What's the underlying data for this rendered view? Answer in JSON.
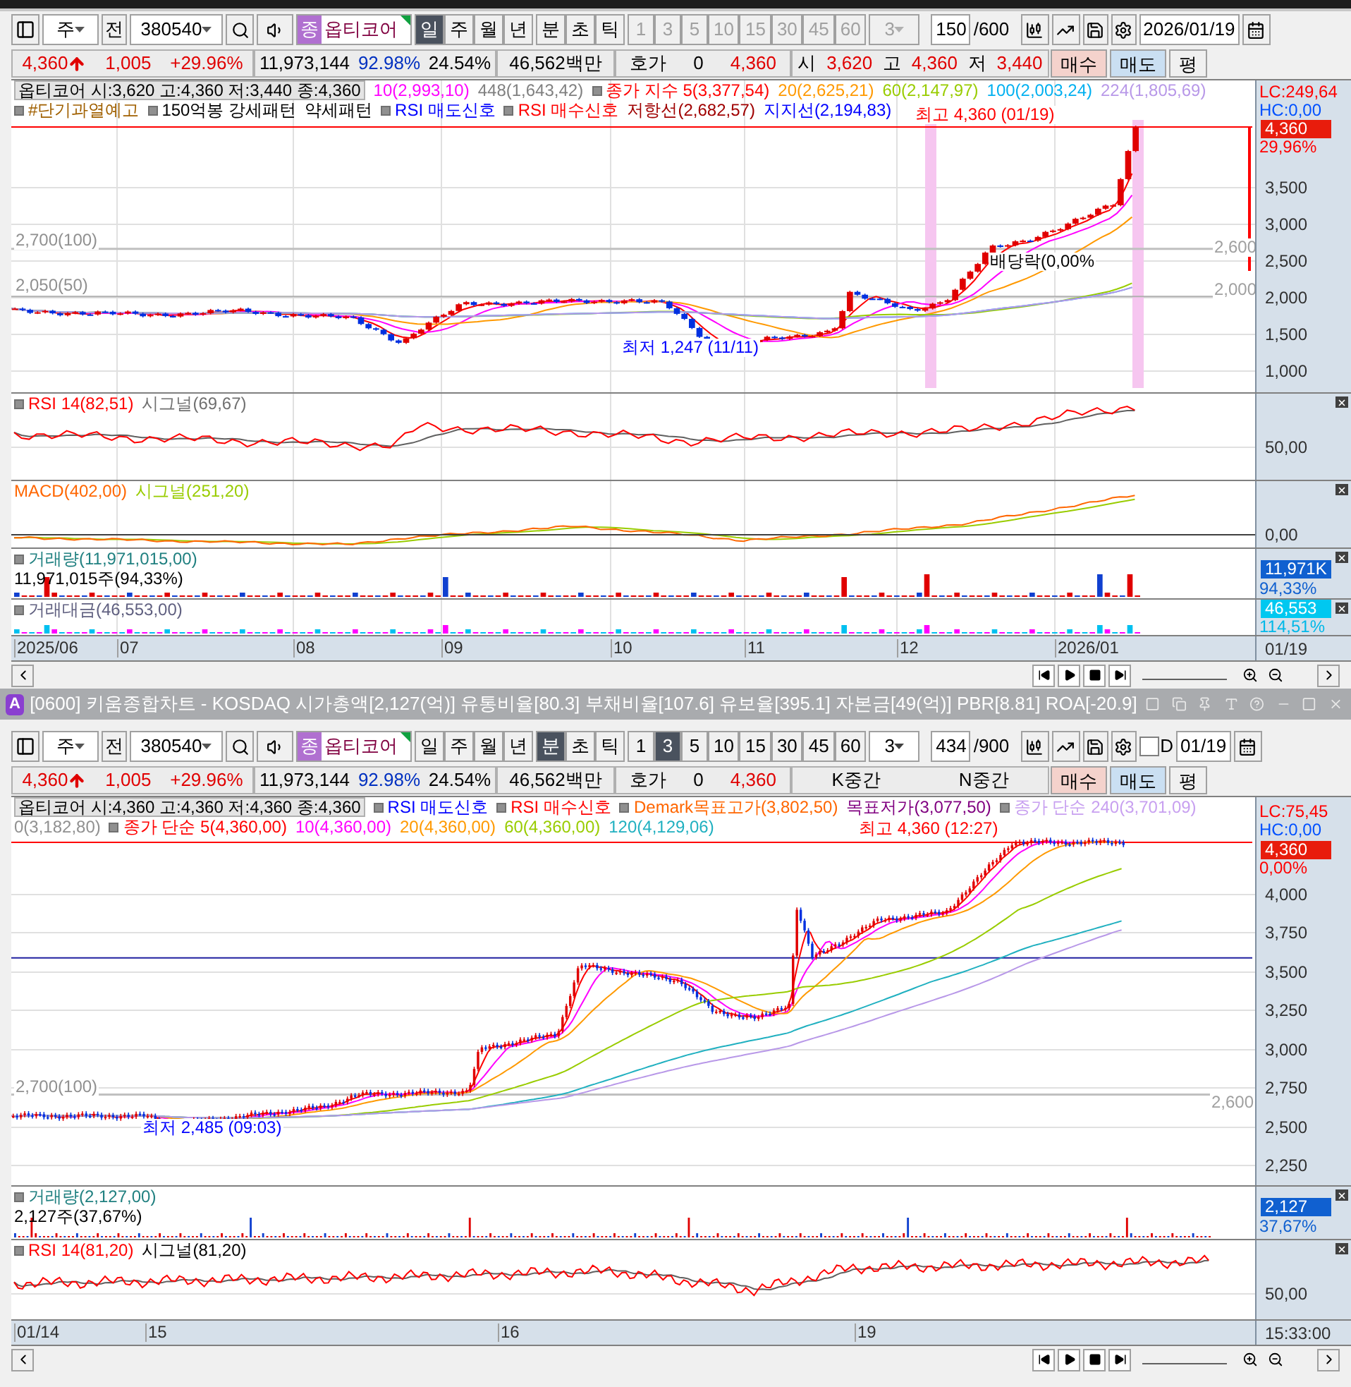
{
  "windows": [
    {
      "toolbar": {
        "market": "주",
        "prev": "전",
        "code": "380540",
        "badge": "종",
        "name": "옵티코어",
        "periods": [
          {
            "label": "일",
            "selected": true
          },
          {
            "label": "주",
            "selected": false
          },
          {
            "label": "월",
            "selected": false
          },
          {
            "label": "년",
            "selected": false
          }
        ],
        "units": [
          {
            "label": "분",
            "selected": false
          },
          {
            "label": "초",
            "selected": false
          },
          {
            "label": "틱",
            "selected": false
          }
        ],
        "intervals": [
          {
            "label": "1",
            "selected": false,
            "disabled": true
          },
          {
            "label": "3",
            "selected": false,
            "disabled": true
          },
          {
            "label": "5",
            "selected": false,
            "disabled": true
          },
          {
            "label": "10",
            "selected": false,
            "disabled": true
          },
          {
            "label": "15",
            "selected": false,
            "disabled": true
          },
          {
            "label": "30",
            "selected": false,
            "disabled": true
          },
          {
            "label": "45",
            "selected": false,
            "disabled": true
          },
          {
            "label": "60",
            "selected": false,
            "disabled": true
          }
        ],
        "multiplier": {
          "value": "3",
          "disabled": true
        },
        "count": "150",
        "total": "/600",
        "date": "2026/01/19"
      },
      "quote": [
        {
          "items": [
            {
              "text": "4,360",
              "color": "#e00000"
            },
            {
              "text": "1,005",
              "color": "#e00000"
            },
            {
              "text": "+29.96%",
              "color": "#e00000"
            }
          ]
        },
        {
          "items": [
            {
              "text": "11,973,144",
              "color": "#000000"
            },
            {
              "text": "92.98%",
              "color": "#0030c0"
            },
            {
              "text": "24.54%",
              "color": "#000000"
            }
          ]
        },
        {
          "items": [
            {
              "text": "46,562백만",
              "color": "#000000"
            }
          ]
        },
        {
          "items": [
            {
              "text": "호가",
              "color": "#000000"
            },
            {
              "text": "0",
              "color": "#000000"
            },
            {
              "text": "4,360",
              "color": "#e00000"
            }
          ]
        },
        {
          "items": [
            {
              "text": "시",
              "color": "#000000"
            },
            {
              "text": "3,620",
              "color": "#e00000"
            },
            {
              "text": "고",
              "color": "#000000"
            },
            {
              "text": "4,360",
              "color": "#e00000"
            },
            {
              "text": "저",
              "color": "#000000"
            },
            {
              "text": "3,440",
              "color": "#e00000"
            }
          ]
        }
      ],
      "buttons": [
        {
          "label": "매수",
          "kind": "buy"
        },
        {
          "label": "매도",
          "kind": "sell"
        },
        {
          "label": "평",
          "kind": "plain"
        }
      ],
      "panes": [
        {
          "kind": "price",
          "legend_rows": [
            [
              {
                "text": "옵티코어 시:3,620 고:4,360 저:3,440 종:4,360",
                "kind": "title",
                "bullet": false,
                "color": "#000000"
              },
              {
                "text": "10(2,993,10)",
                "bullet": false,
                "color": "#ff00ff"
              },
              {
                "text": "448(1,643,42)",
                "bullet": false,
                "color": "#808080"
              },
              {
                "text": "종가 지수 5(3,377,54)",
                "bullet": true,
                "color": "#ff0000"
              },
              {
                "text": "20(2,625,21)",
                "bullet": false,
                "color": "#ff9900"
              },
              {
                "text": "60(2,147,97)",
                "bullet": false,
                "color": "#99cc00"
              },
              {
                "text": "100(2,003,24)",
                "bullet": false,
                "color": "#00b0f0"
              },
              {
                "text": "224(1,805,69)",
                "bullet": false,
                "color": "#b898e8"
              }
            ],
            [
              {
                "text": "#단기과열예고",
                "bullet": true,
                "color": "#a06000"
              },
              {
                "text": "150억봉 강세패턴",
                "bullet": true,
                "color": "#000000"
              },
              {
                "text": "약세패턴",
                "bullet": false,
                "color": "#000000"
              },
              {
                "text": "RSI 매도신호",
                "bullet": true,
                "color": "#0000ff"
              },
              {
                "text": "RSI 매수신호",
                "bullet": true,
                "color": "#ff0000"
              },
              {
                "text": "저항선(2,682,57)",
                "bullet": false,
                "color": "#a00000"
              },
              {
                "text": "지지선(2,194,83)",
                "bullet": false,
                "color": "#0000ff"
              }
            ]
          ],
          "tags": [
            {
              "text": "LC:249,64",
              "kind": "plain",
              "color": "#ff0000"
            },
            {
              "text": "HC:0,00",
              "kind": "plain",
              "color": "#0050ff"
            },
            {
              "text": "4,360",
              "kind": "tag",
              "color": "#e81c0c"
            },
            {
              "text": "29,96%",
              "kind": "plain",
              "color": "#ff0000"
            }
          ],
          "ticks": [
            "3,500",
            "3,000",
            "2,500",
            "2,000",
            "1,500",
            "1,000"
          ],
          "annotations": [
            {
              "text": "최고 4,360 (01/19)",
              "color": "#ff0000"
            },
            {
              "text": "배당락(0,00%",
              "color": "#000000"
            },
            {
              "text": "최저 1,247 (11/11)",
              "color": "#0000ff"
            },
            {
              "text": "2,700(100)",
              "color": "#909090"
            },
            {
              "text": "2,050(50)",
              "color": "#909090"
            },
            {
              "text": "2,600",
              "color": "#a0a0a0"
            },
            {
              "text": "2,000",
              "color": "#a0a0a0"
            }
          ]
        },
        {
          "kind": "rsi",
          "legend_rows": [
            [
              {
                "text": "RSI 14(82,51)",
                "bullet": true,
                "color": "#ff0000"
              },
              {
                "text": "시그널(69,67)",
                "bullet": false,
                "color": "#707070"
              }
            ]
          ],
          "ticks": [
            "50,00"
          ]
        },
        {
          "kind": "macd",
          "legend_rows": [
            [
              {
                "text": "MACD(402,00)",
                "bullet": false,
                "color": "#ff6600"
              },
              {
                "text": "시그널(251,20)",
                "bullet": false,
                "color": "#99cc00"
              }
            ]
          ],
          "ticks": [
            "0,00"
          ]
        },
        {
          "kind": "volume",
          "legend_rows": [
            [
              {
                "text": "거래량(11,971,015,00)",
                "bullet": true,
                "color": "#208080"
              }
            ],
            [
              {
                "text": "11,971,015주(94,33%)",
                "bullet": false,
                "color": "#000000"
              }
            ]
          ],
          "tags": [
            {
              "text": "11,971K",
              "kind": "tag",
              "color": "#1060d0"
            },
            {
              "text": "94,33%",
              "kind": "plain",
              "color": "#1060d0"
            }
          ]
        },
        {
          "kind": "amount",
          "legend_rows": [
            [
              {
                "text": "거래대금(46,553,00)",
                "bullet": true,
                "color": "#606080"
              }
            ]
          ],
          "tags": [
            {
              "text": "46,553",
              "kind": "tag",
              "color": "#00c8f0"
            },
            {
              "text": "114,51%",
              "kind": "plain",
              "color": "#00b8e8"
            }
          ]
        }
      ],
      "x_labels": [
        "2025/06",
        "07",
        "08",
        "09",
        "10",
        "11",
        "12",
        "2026/01"
      ],
      "x_end": "01/19"
    },
    {
      "title": {
        "badge": "A",
        "text": "[0600] 키움종합차트 - KOSDAQ 시가총액[2,127(억)] 유통비율[80.3] 부채비율[107.6] 유보율[395.1] 자본금[49(억)] PBR[8.81] ROA[-20.9]"
      },
      "toolbar": {
        "market": "주",
        "prev": "전",
        "code": "380540",
        "badge": "종",
        "name": "옵티코어",
        "periods": [
          {
            "label": "일",
            "selected": false
          },
          {
            "label": "주",
            "selected": false
          },
          {
            "label": "월",
            "selected": false
          },
          {
            "label": "년",
            "selected": false
          }
        ],
        "units": [
          {
            "label": "분",
            "selected": true
          },
          {
            "label": "초",
            "selected": false
          },
          {
            "label": "틱",
            "selected": false
          }
        ],
        "intervals": [
          {
            "label": "1",
            "selected": false,
            "disabled": false
          },
          {
            "label": "3",
            "selected": true,
            "disabled": false
          },
          {
            "label": "5",
            "selected": false,
            "disabled": false
          },
          {
            "label": "10",
            "selected": false,
            "disabled": false
          },
          {
            "label": "15",
            "selected": false,
            "disabled": false
          },
          {
            "label": "30",
            "selected": false,
            "disabled": false
          },
          {
            "label": "45",
            "selected": false,
            "disabled": false
          },
          {
            "label": "60",
            "selected": false,
            "disabled": false
          }
        ],
        "multiplier": {
          "value": "3",
          "disabled": false
        },
        "count": "434",
        "total": "/900",
        "checkbox": {
          "label": "D",
          "checked": false
        },
        "date": "01/19"
      },
      "quote": [
        {
          "items": [
            {
              "text": "4,360",
              "color": "#e00000"
            },
            {
              "text": "1,005",
              "color": "#e00000"
            },
            {
              "text": "+29.96%",
              "color": "#e00000"
            }
          ]
        },
        {
          "items": [
            {
              "text": "11,973,144",
              "color": "#000000"
            },
            {
              "text": "92.98%",
              "color": "#0030c0"
            },
            {
              "text": "24.54%",
              "color": "#000000"
            }
          ]
        },
        {
          "items": [
            {
              "text": "46,562백만",
              "color": "#000000"
            }
          ]
        },
        {
          "items": [
            {
              "text": "호가",
              "color": "#000000"
            },
            {
              "text": "0",
              "color": "#000000"
            },
            {
              "text": "4,360",
              "color": "#e00000"
            }
          ]
        },
        {
          "items": [
            {
              "text": "K중간",
              "color": "#000000"
            },
            {
              "text": "N중간",
              "color": "#000000"
            }
          ]
        }
      ],
      "buttons": [
        {
          "label": "매수",
          "kind": "buy"
        },
        {
          "label": "매도",
          "kind": "sell"
        },
        {
          "label": "평",
          "kind": "plain"
        }
      ],
      "panes": [
        {
          "kind": "intraday",
          "legend_rows": [
            [
              {
                "text": "옵티코어 시:4,360 고:4,360 저:4,360 종:4,360",
                "kind": "title",
                "bullet": false,
                "color": "#000000"
              },
              {
                "text": "RSI 매도신호",
                "bullet": true,
                "color": "#0000ff"
              },
              {
                "text": "RSI 매수신호",
                "bullet": true,
                "color": "#ff0000"
              },
              {
                "text": "Demark목표고가(3,802,50)",
                "bullet": true,
                "color": "#ff6600"
              },
              {
                "text": "목표저가(3,077,50)",
                "bullet": false,
                "color": "#800080"
              },
              {
                "text": "종가 단순 240(3,701,09)",
                "bullet": true,
                "color": "#c8a0f0"
              }
            ],
            [
              {
                "text": "0(3,182,80)",
                "bullet": false,
                "color": "#909090"
              },
              {
                "text": "종가 단순 5(4,360,00)",
                "bullet": true,
                "color": "#ff0000"
              },
              {
                "text": "10(4,360,00)",
                "bullet": false,
                "color": "#ff00ff"
              },
              {
                "text": "20(4,360,00)",
                "bullet": false,
                "color": "#ff9900"
              },
              {
                "text": "60(4,360,00)",
                "bullet": false,
                "color": "#99cc00"
              },
              {
                "text": "120(4,129,06)",
                "bullet": false,
                "color": "#20b0c0"
              }
            ]
          ],
          "tags": [
            {
              "text": "LC:75,45",
              "kind": "plain",
              "color": "#ff0000"
            },
            {
              "text": "HC:0,00",
              "kind": "plain",
              "color": "#0050ff"
            },
            {
              "text": "4,360",
              "kind": "tag",
              "color": "#e81c0c"
            },
            {
              "text": "0,00%",
              "kind": "plain",
              "color": "#ff0000"
            }
          ],
          "ticks": [
            "4,000",
            "3,750",
            "3,500",
            "3,250",
            "3,000",
            "2,750",
            "2,500",
            "2,250"
          ],
          "annotations": [
            {
              "text": "최고 4,360 (12:27)",
              "color": "#ff0000"
            },
            {
              "text": "최저 2,485 (09:03)",
              "color": "#0000ff"
            },
            {
              "text": "2,700(100)",
              "color": "#909090"
            },
            {
              "text": "2,600",
              "color": "#a0a0a0"
            }
          ]
        },
        {
          "kind": "volume",
          "legend_rows": [
            [
              {
                "text": "거래량(2,127,00)",
                "bullet": true,
                "color": "#208080"
              }
            ],
            [
              {
                "text": "2,127주(37,67%)",
                "bullet": false,
                "color": "#000000"
              }
            ]
          ],
          "tags": [
            {
              "text": "2,127",
              "kind": "tag",
              "color": "#1060d0"
            },
            {
              "text": "37,67%",
              "kind": "plain",
              "color": "#1060d0"
            }
          ]
        },
        {
          "kind": "rsi",
          "legend_rows": [
            [
              {
                "text": "RSI 14(81,20)",
                "bullet": true,
                "color": "#ff0000"
              },
              {
                "text": "시그널(81,20)",
                "bullet": false,
                "color": "#000000"
              }
            ]
          ],
          "ticks": [
            "50,00"
          ]
        }
      ],
      "x_labels": [
        "01/14",
        "15",
        "16",
        "19"
      ],
      "x_end": "15:33:00"
    }
  ]
}
